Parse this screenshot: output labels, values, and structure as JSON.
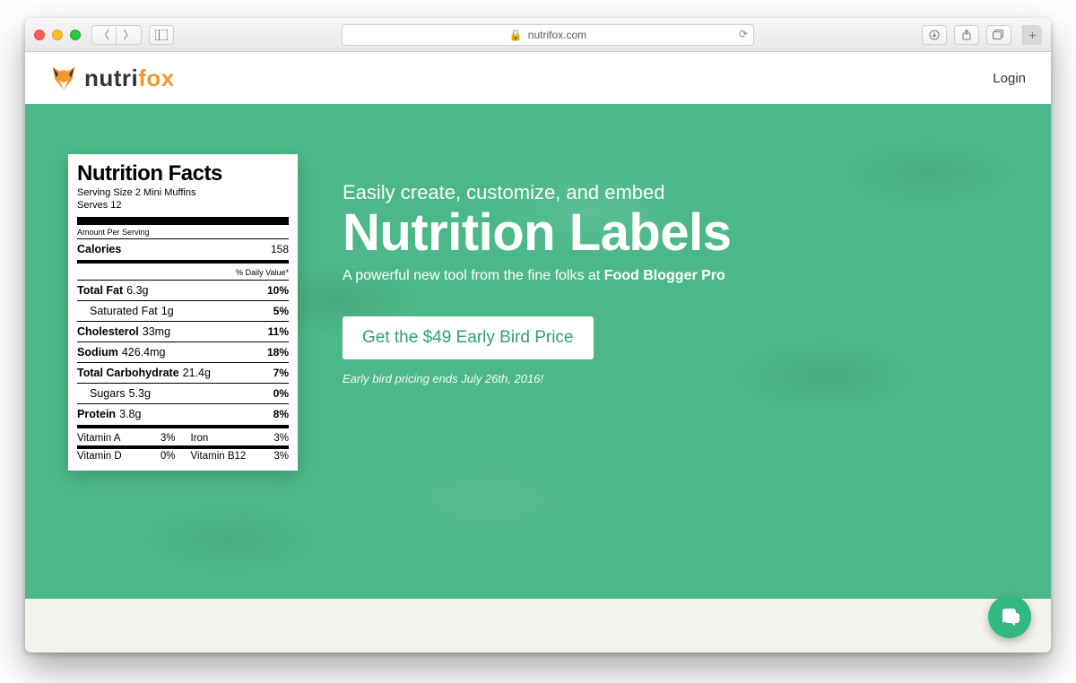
{
  "browser": {
    "address": "nutrifox.com",
    "lock": "🔒"
  },
  "nav": {
    "brand_plain": "nutri",
    "brand_accent": "fox",
    "login": "Login"
  },
  "hero": {
    "eyebrow": "Easily create, customize, and embed",
    "headline": "Nutrition Labels",
    "tagline_prefix": "A powerful new tool from the fine folks at ",
    "tagline_strong": "Food Blogger Pro",
    "cta": "Get the $49 Early Bird Price",
    "deadline": "Early bird pricing ends July 26th, 2016!"
  },
  "label": {
    "title": "Nutrition Facts",
    "serving_size": "Serving Size 2 Mini Muffins",
    "serves": "Serves 12",
    "amount_per_serving": "Amount Per Serving",
    "calories_label": "Calories",
    "calories_value": "158",
    "daily_value_note": "% Daily Value*",
    "rows": [
      {
        "name": "Total Fat",
        "amt": "6.3g",
        "dv": "10%",
        "bold": true
      },
      {
        "name": "Saturated Fat",
        "amt": "1g",
        "dv": "5%",
        "indent": true
      },
      {
        "name": "Cholesterol",
        "amt": "33mg",
        "dv": "11%",
        "bold": true
      },
      {
        "name": "Sodium",
        "amt": "426.4mg",
        "dv": "18%",
        "bold": true
      },
      {
        "name": "Total Carbohydrate",
        "amt": "21.4g",
        "dv": "7%",
        "bold": true
      },
      {
        "name": "Sugars",
        "amt": "5.3g",
        "dv": "0%",
        "indent": true
      },
      {
        "name": "Protein",
        "amt": "3.8g",
        "dv": "8%",
        "bold": true
      }
    ],
    "vitamins": [
      {
        "l_name": "Vitamin A",
        "l_pct": "3%",
        "r_name": "Iron",
        "r_pct": "3%"
      },
      {
        "l_name": "Vitamin D",
        "l_pct": "0%",
        "r_name": "Vitamin B12",
        "r_pct": "3%"
      }
    ]
  }
}
